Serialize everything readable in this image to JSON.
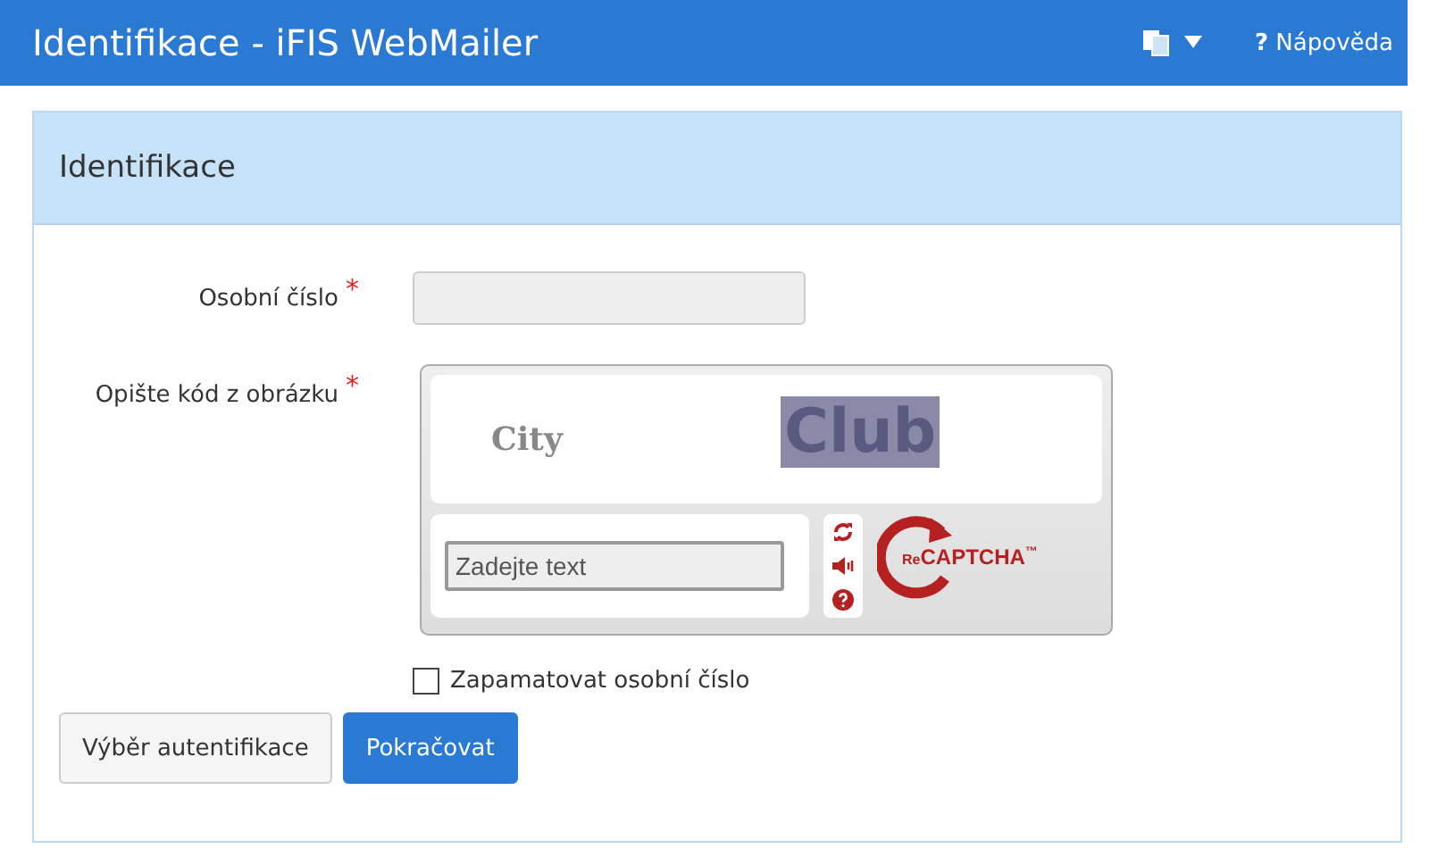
{
  "header": {
    "title": "Identifikace - iFIS WebMailer",
    "help": {
      "mark": "?",
      "label": "Nápověda"
    }
  },
  "panel": {
    "heading": "Identifikace"
  },
  "fields": [
    {
      "label": "Osobní číslo",
      "required": "*",
      "kind": "text"
    },
    {
      "label": "Opište kód z obrázku",
      "required": "*",
      "kind": "captcha"
    }
  ],
  "captcha": {
    "words": [
      "City",
      "Club"
    ],
    "input": {
      "placeholder": "Zadejte text"
    },
    "logo": {
      "prefix": "Re",
      "name": "CAPTCHA",
      "mark": "™"
    }
  },
  "remember": {
    "label": "Zapamatovat osobní číslo",
    "checked": false
  },
  "buttons": [
    {
      "label": "Výběr autentifikace",
      "kind": "default"
    },
    {
      "label": "Pokračovat",
      "kind": "primary"
    }
  ]
}
